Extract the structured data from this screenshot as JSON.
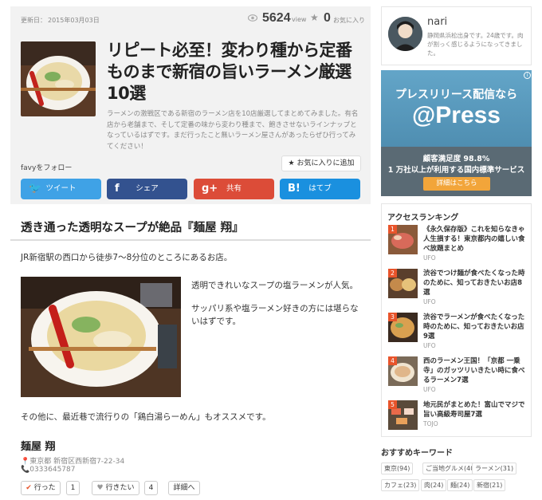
{
  "article": {
    "updated_label": "更新日：",
    "updated_date": "2015年03月03日",
    "views": "5624",
    "views_unit": "view",
    "favorites": "0",
    "favorites_unit": "お気に入り",
    "title": "リピート必至！変わり種から定番ものまで新宿の旨いラーメン厳選10選",
    "description": "ラーメンの激戦区である新宿のラーメン店を10店厳選してまとめてみました。有名店から老舗まで、そして定番の味から変わり種まで、飽きさせないラインナップとなっているはずです。まだ行ったこと無いラーメン屋さんがあったらぜひ行ってみてください！",
    "follow_label": "favyをフォロー",
    "fav_add_label": "お気に入りに追加",
    "share": {
      "twitter": "ツイート",
      "facebook": "シェア",
      "gplus": "共有",
      "hatena": "はてブ"
    },
    "section_heading": "透き通った透明なスープが絶品『麺屋 翔』",
    "p1": "JR新宿駅の西口から徒歩7～8分位のところにあるお店。",
    "p2": "透明できれいなスープの塩ラーメンが人気。",
    "p3": "サッパリ系や塩ラーメン好きの方には堪らないはずです。",
    "p4": "その他に、最近巷で流行りの「鶏白湯らーめん」もオススメです。",
    "shop_name": "麺屋 翔",
    "address": "東京都 新宿区西新宿7-22-34",
    "tel": "0333645787",
    "went_label": "行った",
    "went_count": "1",
    "want_label": "行きたい",
    "want_count": "4",
    "detail_label": "詳細へ"
  },
  "profile": {
    "name": "nari",
    "bio": "静岡県浜松出身です。24歳です。肉が割っく感じるようになってきました。"
  },
  "ad": {
    "headline": "プレスリリース配信なら",
    "brand": "@Press",
    "line1": "顧客満足度 98.8%",
    "line2": "1 万社以上が利用する国内標準サービス",
    "button": "詳細はこちら",
    "info_icon": "i"
  },
  "ranking": {
    "title": "アクセスランキング",
    "items": [
      {
        "rank": "1",
        "text": "《永久保存版》これを知らなきゃ人生損する！東京都内の嬉しい食べ放題まとめ",
        "source": "UFO"
      },
      {
        "rank": "2",
        "text": "渋谷でつけ麺が食べたくなった時のために、知っておきたいお店8選",
        "source": "UFO"
      },
      {
        "rank": "3",
        "text": "渋谷でラーメンが食べたくなった時のために、知っておきたいお店9選",
        "source": "UFO"
      },
      {
        "rank": "4",
        "text": "西のラーメン王国！「京都 一乗寺」のガッツリいきたい時に食べるラーメン7選",
        "source": "UFO"
      },
      {
        "rank": "5",
        "text": "地元民がまとめた！富山でマジで旨い高級寿司屋7選",
        "source": "TOJO"
      }
    ]
  },
  "keywords": {
    "title": "おすすめキーワード",
    "items": [
      "東京(94)",
      "ご当地グルメ(40)",
      "ラーメン(31)",
      "カフェ(23)",
      "肉(24)",
      "麺(24)",
      "新宿(21)"
    ]
  }
}
